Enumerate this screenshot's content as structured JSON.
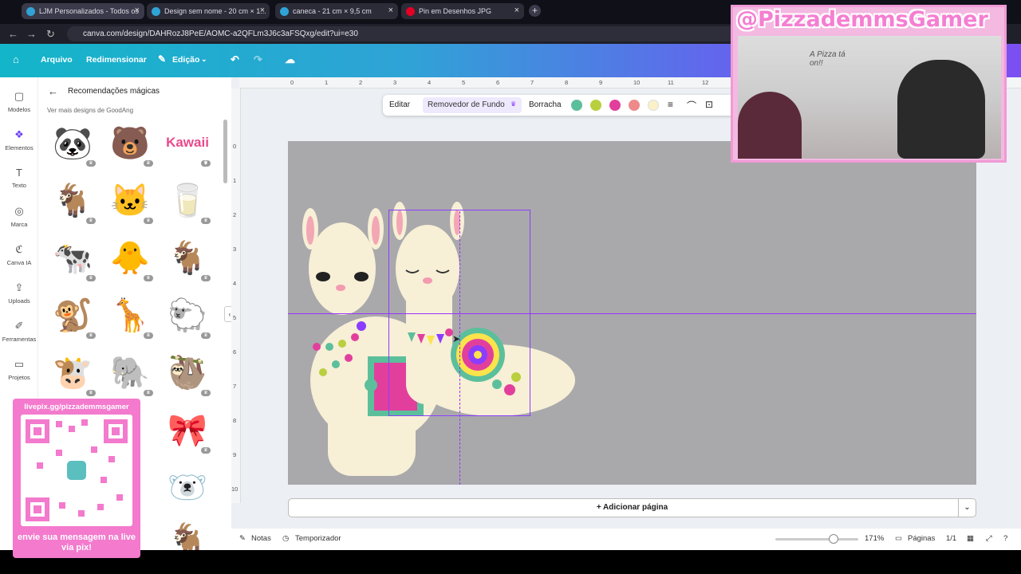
{
  "browser": {
    "tabs": [
      {
        "label": "LJM Personalizados - Todos os",
        "fav_color": "#2fa3d6"
      },
      {
        "label": "Design sem nome - 20 cm × 1...",
        "fav_color": "#2fa3d6"
      },
      {
        "label": "caneca - 21 cm × 9,5 cm",
        "fav_color": "#2fa3d6"
      },
      {
        "label": "Pin em Desenhos JPG",
        "fav_color": "#e60023"
      }
    ],
    "url": "canva.com/design/DAHRozJ8PeE/AOMC-a2QFLm3J6c3aFSQxg/edit?ui=e30"
  },
  "toolbar": {
    "file": "Arquivo",
    "resize": "Redimensionar",
    "edit": "Edição"
  },
  "rail": [
    {
      "label": "Modelos",
      "icon": "template-icon"
    },
    {
      "label": "Elementos",
      "icon": "elements-icon"
    },
    {
      "label": "Texto",
      "icon": "text-icon"
    },
    {
      "label": "Marca",
      "icon": "brand-icon"
    },
    {
      "label": "Canva IA",
      "icon": "ai-icon"
    },
    {
      "label": "Uploads",
      "icon": "upload-icon"
    },
    {
      "label": "Ferramentas",
      "icon": "tools-icon"
    },
    {
      "label": "Projetos",
      "icon": "folder-icon"
    }
  ],
  "panel": {
    "title": "Recomendações mágicas",
    "subtitle": "Ver mais designs de GoodAng",
    "kawaii": "Kawaii"
  },
  "floating_toolbar": {
    "edit": "Editar",
    "bg_remover": "Removedor de Fundo",
    "eraser": "Borracha",
    "swatches": [
      "#5cbf9b",
      "#b9cf3d",
      "#e23f9d",
      "#ee8a8a",
      "#fbf1c9"
    ]
  },
  "rulers": {
    "top": [
      "0",
      "1",
      "2",
      "3",
      "4",
      "5",
      "6",
      "7",
      "8",
      "9",
      "10",
      "11",
      "12"
    ],
    "left": [
      "0",
      "1",
      "2",
      "3",
      "4",
      "5",
      "6",
      "7",
      "8",
      "9",
      "10"
    ]
  },
  "canvas": {
    "add_page": "+ Adicionar página"
  },
  "footer": {
    "notes": "Notas",
    "timer": "Temporizador",
    "zoom": "171%",
    "pages_label": "Páginas",
    "pages_count": "1/1"
  },
  "stream": {
    "handle": "@PizzademmsGamer",
    "qr_top": "livepix.gg/pizzademmsgamer",
    "qr_bottom": "envie sua mensagem na live via pix!",
    "sign": "A Pizza tá on!!"
  }
}
